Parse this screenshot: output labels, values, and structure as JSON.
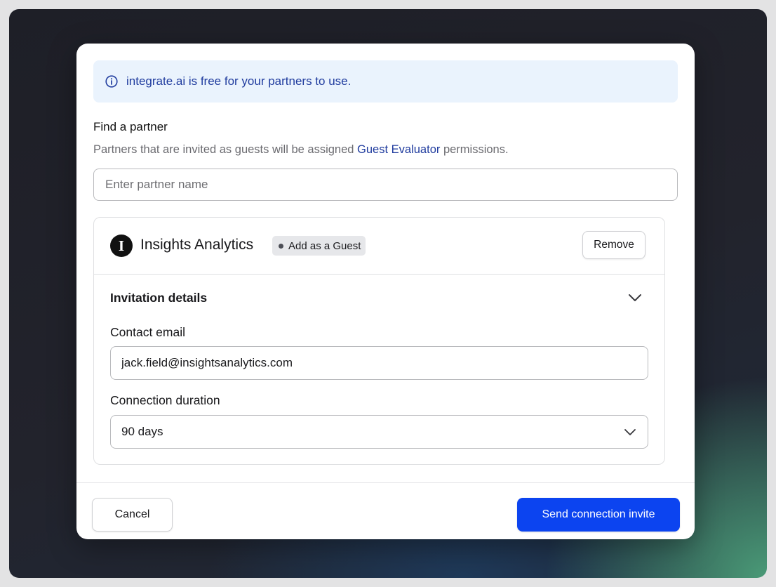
{
  "banner": {
    "icon": "info-circle-icon",
    "text": "integrate.ai is free for your partners to use."
  },
  "find_partner": {
    "label": "Find a partner",
    "help_prefix": "Partners that are invited as guests will be assigned ",
    "help_link": "Guest Evaluator",
    "help_suffix": " permissions.",
    "placeholder": "Enter partner name",
    "value": ""
  },
  "partner": {
    "logo_letter": "I",
    "name": "Insights Analytics",
    "badge": "Add as a Guest",
    "remove_label": "Remove"
  },
  "invitation": {
    "title": "Invitation details",
    "chevron": "chevron-down-icon",
    "email_label": "Contact email",
    "email_value": "jack.field@insightsanalytics.com",
    "duration_label": "Connection duration",
    "duration_value": "90 days"
  },
  "footer": {
    "cancel_label": "Cancel",
    "send_label": "Send connection invite"
  },
  "colors": {
    "accent": "#0c44f0",
    "banner_bg": "#eaf3fd",
    "banner_text": "#1f3b9e"
  }
}
